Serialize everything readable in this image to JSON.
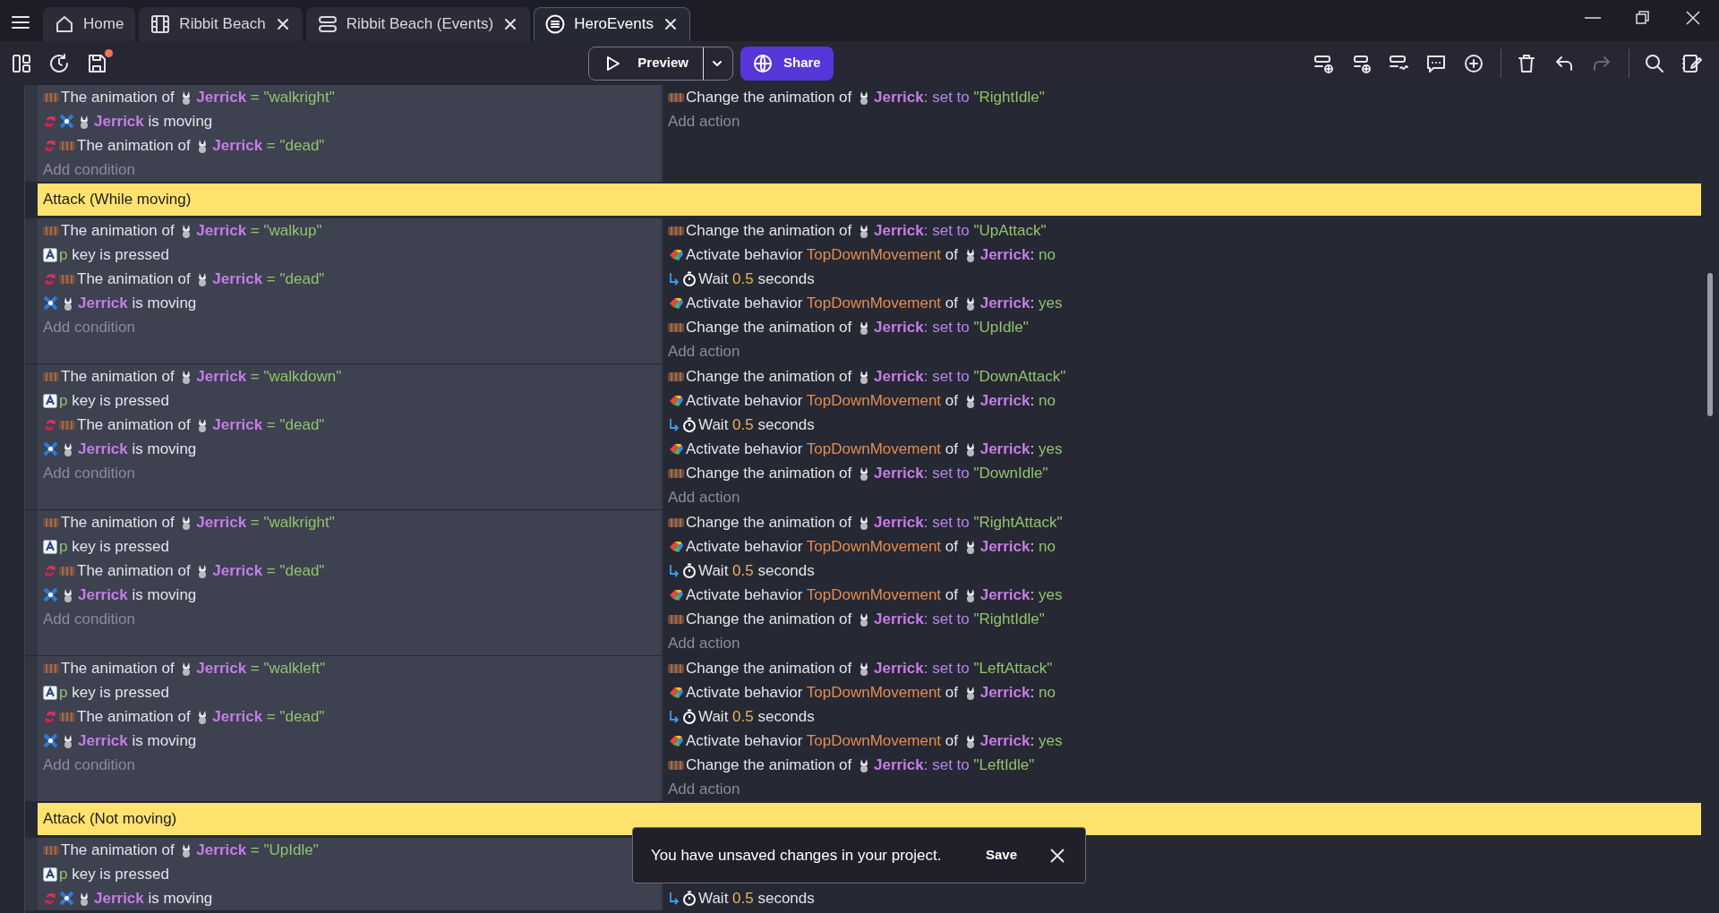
{
  "tabs": [
    {
      "label": "Home",
      "selected": false,
      "closable": false
    },
    {
      "label": "Ribbit Beach",
      "selected": false,
      "closable": true
    },
    {
      "label": "Ribbit Beach (Events)",
      "selected": false,
      "closable": true
    },
    {
      "label": "HeroEvents",
      "selected": true,
      "closable": true
    }
  ],
  "toolbar": {
    "unsaved": true,
    "preview": "Preview",
    "share": "Share",
    "redo_disabled": true
  },
  "sheet": [
    {
      "kind": "event",
      "conditions": [
        {
          "kind": "animation",
          "inverted": false,
          "parts": [
            {
              "kind": "text",
              "text": "The animation of "
            },
            {
              "kind": "object",
              "text": "Jerrick"
            },
            {
              "kind": "value",
              "text": " = \"walkright\""
            }
          ]
        },
        {
          "kind": "moving",
          "inverted": true,
          "parts": [
            {
              "kind": "object",
              "text": "Jerrick"
            },
            {
              "kind": "text",
              "text": " is moving"
            }
          ]
        },
        {
          "kind": "animation",
          "inverted": true,
          "parts": [
            {
              "kind": "text",
              "text": "The animation of "
            },
            {
              "kind": "object",
              "text": "Jerrick"
            },
            {
              "kind": "value",
              "text": " = \"dead\""
            }
          ]
        }
      ],
      "add_condition": "Add condition",
      "actions": [
        {
          "kind": "animation",
          "inverted": false,
          "parts": [
            {
              "kind": "text",
              "text": "Change the animation of "
            },
            {
              "kind": "object",
              "text": "Jerrick"
            },
            {
              "kind": "keyword",
              "text": ": set to "
            },
            {
              "kind": "value",
              "text": "\"RightIdle\""
            }
          ]
        }
      ],
      "add_action": "Add action"
    },
    {
      "kind": "group",
      "title": "Attack (While moving)"
    },
    {
      "kind": "event",
      "conditions": [
        {
          "kind": "animation",
          "inverted": false,
          "parts": [
            {
              "kind": "text",
              "text": "The animation of "
            },
            {
              "kind": "object",
              "text": "Jerrick"
            },
            {
              "kind": "value",
              "text": " = \"walkup\""
            }
          ]
        },
        {
          "kind": "key",
          "inverted": false,
          "parts": [
            {
              "kind": "value",
              "text": "p"
            },
            {
              "kind": "text",
              "text": " key is pressed"
            }
          ]
        },
        {
          "kind": "animation",
          "inverted": true,
          "parts": [
            {
              "kind": "text",
              "text": "The animation of "
            },
            {
              "kind": "object",
              "text": "Jerrick"
            },
            {
              "kind": "value",
              "text": " = \"dead\""
            }
          ]
        },
        {
          "kind": "moving",
          "inverted": false,
          "parts": [
            {
              "kind": "object",
              "text": "Jerrick"
            },
            {
              "kind": "text",
              "text": " is moving"
            }
          ]
        }
      ],
      "add_condition": "Add condition",
      "actions": [
        {
          "kind": "animation",
          "inverted": false,
          "parts": [
            {
              "kind": "text",
              "text": "Change the animation of "
            },
            {
              "kind": "object",
              "text": "Jerrick"
            },
            {
              "kind": "keyword",
              "text": ": set to "
            },
            {
              "kind": "value",
              "text": "\"UpAttack\""
            }
          ]
        },
        {
          "kind": "behavior",
          "inverted": false,
          "parts": [
            {
              "kind": "text",
              "text": "Activate behavior "
            },
            {
              "kind": "behavior",
              "text": "TopDownMovement"
            },
            {
              "kind": "text",
              "text": " of "
            },
            {
              "kind": "object",
              "text": "Jerrick"
            },
            {
              "kind": "text",
              "text": ": "
            },
            {
              "kind": "value",
              "text": "no"
            }
          ]
        },
        {
          "kind": "wait",
          "inverted": false,
          "parts": [
            {
              "kind": "text",
              "text": "Wait "
            },
            {
              "kind": "number",
              "text": "0.5"
            },
            {
              "kind": "text",
              "text": " seconds"
            }
          ]
        },
        {
          "kind": "behavior",
          "inverted": false,
          "parts": [
            {
              "kind": "text",
              "text": "Activate behavior "
            },
            {
              "kind": "behavior",
              "text": "TopDownMovement"
            },
            {
              "kind": "text",
              "text": " of "
            },
            {
              "kind": "object",
              "text": "Jerrick"
            },
            {
              "kind": "text",
              "text": ": "
            },
            {
              "kind": "value",
              "text": "yes"
            }
          ]
        },
        {
          "kind": "animation",
          "inverted": false,
          "parts": [
            {
              "kind": "text",
              "text": "Change the animation of "
            },
            {
              "kind": "object",
              "text": "Jerrick"
            },
            {
              "kind": "keyword",
              "text": ": set to "
            },
            {
              "kind": "value",
              "text": "\"UpIdle\""
            }
          ]
        }
      ],
      "add_action": "Add action"
    },
    {
      "kind": "event",
      "conditions": [
        {
          "kind": "animation",
          "inverted": false,
          "parts": [
            {
              "kind": "text",
              "text": "The animation of "
            },
            {
              "kind": "object",
              "text": "Jerrick"
            },
            {
              "kind": "value",
              "text": " = \"walkdown\""
            }
          ]
        },
        {
          "kind": "key",
          "inverted": false,
          "parts": [
            {
              "kind": "value",
              "text": "p"
            },
            {
              "kind": "text",
              "text": " key is pressed"
            }
          ]
        },
        {
          "kind": "animation",
          "inverted": true,
          "parts": [
            {
              "kind": "text",
              "text": "The animation of "
            },
            {
              "kind": "object",
              "text": "Jerrick"
            },
            {
              "kind": "value",
              "text": " = \"dead\""
            }
          ]
        },
        {
          "kind": "moving",
          "inverted": false,
          "parts": [
            {
              "kind": "object",
              "text": "Jerrick"
            },
            {
              "kind": "text",
              "text": " is moving"
            }
          ]
        }
      ],
      "add_condition": "Add condition",
      "actions": [
        {
          "kind": "animation",
          "inverted": false,
          "parts": [
            {
              "kind": "text",
              "text": "Change the animation of "
            },
            {
              "kind": "object",
              "text": "Jerrick"
            },
            {
              "kind": "keyword",
              "text": ": set to "
            },
            {
              "kind": "value",
              "text": "\"DownAttack\""
            }
          ]
        },
        {
          "kind": "behavior",
          "inverted": false,
          "parts": [
            {
              "kind": "text",
              "text": "Activate behavior "
            },
            {
              "kind": "behavior",
              "text": "TopDownMovement"
            },
            {
              "kind": "text",
              "text": " of "
            },
            {
              "kind": "object",
              "text": "Jerrick"
            },
            {
              "kind": "text",
              "text": ": "
            },
            {
              "kind": "value",
              "text": "no"
            }
          ]
        },
        {
          "kind": "wait",
          "inverted": false,
          "parts": [
            {
              "kind": "text",
              "text": "Wait "
            },
            {
              "kind": "number",
              "text": "0.5"
            },
            {
              "kind": "text",
              "text": " seconds"
            }
          ]
        },
        {
          "kind": "behavior",
          "inverted": false,
          "parts": [
            {
              "kind": "text",
              "text": "Activate behavior "
            },
            {
              "kind": "behavior",
              "text": "TopDownMovement"
            },
            {
              "kind": "text",
              "text": " of "
            },
            {
              "kind": "object",
              "text": "Jerrick"
            },
            {
              "kind": "text",
              "text": ": "
            },
            {
              "kind": "value",
              "text": "yes"
            }
          ]
        },
        {
          "kind": "animation",
          "inverted": false,
          "parts": [
            {
              "kind": "text",
              "text": "Change the animation of "
            },
            {
              "kind": "object",
              "text": "Jerrick"
            },
            {
              "kind": "keyword",
              "text": ": set to "
            },
            {
              "kind": "value",
              "text": "\"DownIdle\""
            }
          ]
        }
      ],
      "add_action": "Add action"
    },
    {
      "kind": "event",
      "conditions": [
        {
          "kind": "animation",
          "inverted": false,
          "parts": [
            {
              "kind": "text",
              "text": "The animation of "
            },
            {
              "kind": "object",
              "text": "Jerrick"
            },
            {
              "kind": "value",
              "text": " = \"walkright\""
            }
          ]
        },
        {
          "kind": "key",
          "inverted": false,
          "parts": [
            {
              "kind": "value",
              "text": "p"
            },
            {
              "kind": "text",
              "text": " key is pressed"
            }
          ]
        },
        {
          "kind": "animation",
          "inverted": true,
          "parts": [
            {
              "kind": "text",
              "text": "The animation of "
            },
            {
              "kind": "object",
              "text": "Jerrick"
            },
            {
              "kind": "value",
              "text": " = \"dead\""
            }
          ]
        },
        {
          "kind": "moving",
          "inverted": false,
          "parts": [
            {
              "kind": "object",
              "text": "Jerrick"
            },
            {
              "kind": "text",
              "text": " is moving"
            }
          ]
        }
      ],
      "add_condition": "Add condition",
      "actions": [
        {
          "kind": "animation",
          "inverted": false,
          "parts": [
            {
              "kind": "text",
              "text": "Change the animation of "
            },
            {
              "kind": "object",
              "text": "Jerrick"
            },
            {
              "kind": "keyword",
              "text": ": set to "
            },
            {
              "kind": "value",
              "text": "\"RightAttack\""
            }
          ]
        },
        {
          "kind": "behavior",
          "inverted": false,
          "parts": [
            {
              "kind": "text",
              "text": "Activate behavior "
            },
            {
              "kind": "behavior",
              "text": "TopDownMovement"
            },
            {
              "kind": "text",
              "text": " of "
            },
            {
              "kind": "object",
              "text": "Jerrick"
            },
            {
              "kind": "text",
              "text": ": "
            },
            {
              "kind": "value",
              "text": "no"
            }
          ]
        },
        {
          "kind": "wait",
          "inverted": false,
          "parts": [
            {
              "kind": "text",
              "text": "Wait "
            },
            {
              "kind": "number",
              "text": "0.5"
            },
            {
              "kind": "text",
              "text": " seconds"
            }
          ]
        },
        {
          "kind": "behavior",
          "inverted": false,
          "parts": [
            {
              "kind": "text",
              "text": "Activate behavior "
            },
            {
              "kind": "behavior",
              "text": "TopDownMovement"
            },
            {
              "kind": "text",
              "text": " of "
            },
            {
              "kind": "object",
              "text": "Jerrick"
            },
            {
              "kind": "text",
              "text": ": "
            },
            {
              "kind": "value",
              "text": "yes"
            }
          ]
        },
        {
          "kind": "animation",
          "inverted": false,
          "parts": [
            {
              "kind": "text",
              "text": "Change the animation of "
            },
            {
              "kind": "object",
              "text": "Jerrick"
            },
            {
              "kind": "keyword",
              "text": ": set to "
            },
            {
              "kind": "value",
              "text": "\"RightIdle\""
            }
          ]
        }
      ],
      "add_action": "Add action"
    },
    {
      "kind": "event",
      "conditions": [
        {
          "kind": "animation",
          "inverted": false,
          "parts": [
            {
              "kind": "text",
              "text": "The animation of "
            },
            {
              "kind": "object",
              "text": "Jerrick"
            },
            {
              "kind": "value",
              "text": " = \"walkleft\""
            }
          ]
        },
        {
          "kind": "key",
          "inverted": false,
          "parts": [
            {
              "kind": "value",
              "text": "p"
            },
            {
              "kind": "text",
              "text": " key is pressed"
            }
          ]
        },
        {
          "kind": "animation",
          "inverted": true,
          "parts": [
            {
              "kind": "text",
              "text": "The animation of "
            },
            {
              "kind": "object",
              "text": "Jerrick"
            },
            {
              "kind": "value",
              "text": " = \"dead\""
            }
          ]
        },
        {
          "kind": "moving",
          "inverted": false,
          "parts": [
            {
              "kind": "object",
              "text": "Jerrick"
            },
            {
              "kind": "text",
              "text": " is moving"
            }
          ]
        }
      ],
      "add_condition": "Add condition",
      "actions": [
        {
          "kind": "animation",
          "inverted": false,
          "parts": [
            {
              "kind": "text",
              "text": "Change the animation of "
            },
            {
              "kind": "object",
              "text": "Jerrick"
            },
            {
              "kind": "keyword",
              "text": ": set to "
            },
            {
              "kind": "value",
              "text": "\"LeftAttack\""
            }
          ]
        },
        {
          "kind": "behavior",
          "inverted": false,
          "parts": [
            {
              "kind": "text",
              "text": "Activate behavior "
            },
            {
              "kind": "behavior",
              "text": "TopDownMovement"
            },
            {
              "kind": "text",
              "text": " of "
            },
            {
              "kind": "object",
              "text": "Jerrick"
            },
            {
              "kind": "text",
              "text": ": "
            },
            {
              "kind": "value",
              "text": "no"
            }
          ]
        },
        {
          "kind": "wait",
          "inverted": false,
          "parts": [
            {
              "kind": "text",
              "text": "Wait "
            },
            {
              "kind": "number",
              "text": "0.5"
            },
            {
              "kind": "text",
              "text": " seconds"
            }
          ]
        },
        {
          "kind": "behavior",
          "inverted": false,
          "parts": [
            {
              "kind": "text",
              "text": "Activate behavior "
            },
            {
              "kind": "behavior",
              "text": "TopDownMovement"
            },
            {
              "kind": "text",
              "text": " of "
            },
            {
              "kind": "object",
              "text": "Jerrick"
            },
            {
              "kind": "text",
              "text": ": "
            },
            {
              "kind": "value",
              "text": "yes"
            }
          ]
        },
        {
          "kind": "animation",
          "inverted": false,
          "parts": [
            {
              "kind": "text",
              "text": "Change the animation of "
            },
            {
              "kind": "object",
              "text": "Jerrick"
            },
            {
              "kind": "keyword",
              "text": ": set to "
            },
            {
              "kind": "value",
              "text": "\"LeftIdle\""
            }
          ]
        }
      ],
      "add_action": "Add action"
    },
    {
      "kind": "group",
      "title": "Attack (Not moving)"
    },
    {
      "kind": "event",
      "conditions": [
        {
          "kind": "animation",
          "inverted": false,
          "parts": [
            {
              "kind": "text",
              "text": "The animation of "
            },
            {
              "kind": "object",
              "text": "Jerrick"
            },
            {
              "kind": "value",
              "text": " = \"UpIdle\""
            }
          ]
        },
        {
          "kind": "key",
          "inverted": false,
          "parts": [
            {
              "kind": "value",
              "text": "p"
            },
            {
              "kind": "text",
              "text": " key is pressed"
            }
          ]
        },
        {
          "kind": "moving",
          "inverted": true,
          "parts": [
            {
              "kind": "object",
              "text": "Jerrick"
            },
            {
              "kind": "text",
              "text": " is moving"
            }
          ]
        }
      ],
      "actions": [
        {
          "kind": "wait",
          "inverted": false,
          "parts": [
            {
              "kind": "text",
              "text": "Wait "
            },
            {
              "kind": "number",
              "text": "0.5"
            },
            {
              "kind": "text",
              "text": " seconds"
            }
          ]
        }
      ]
    }
  ],
  "toast": {
    "message": "You have unsaved changes in your project.",
    "action": "Save"
  }
}
